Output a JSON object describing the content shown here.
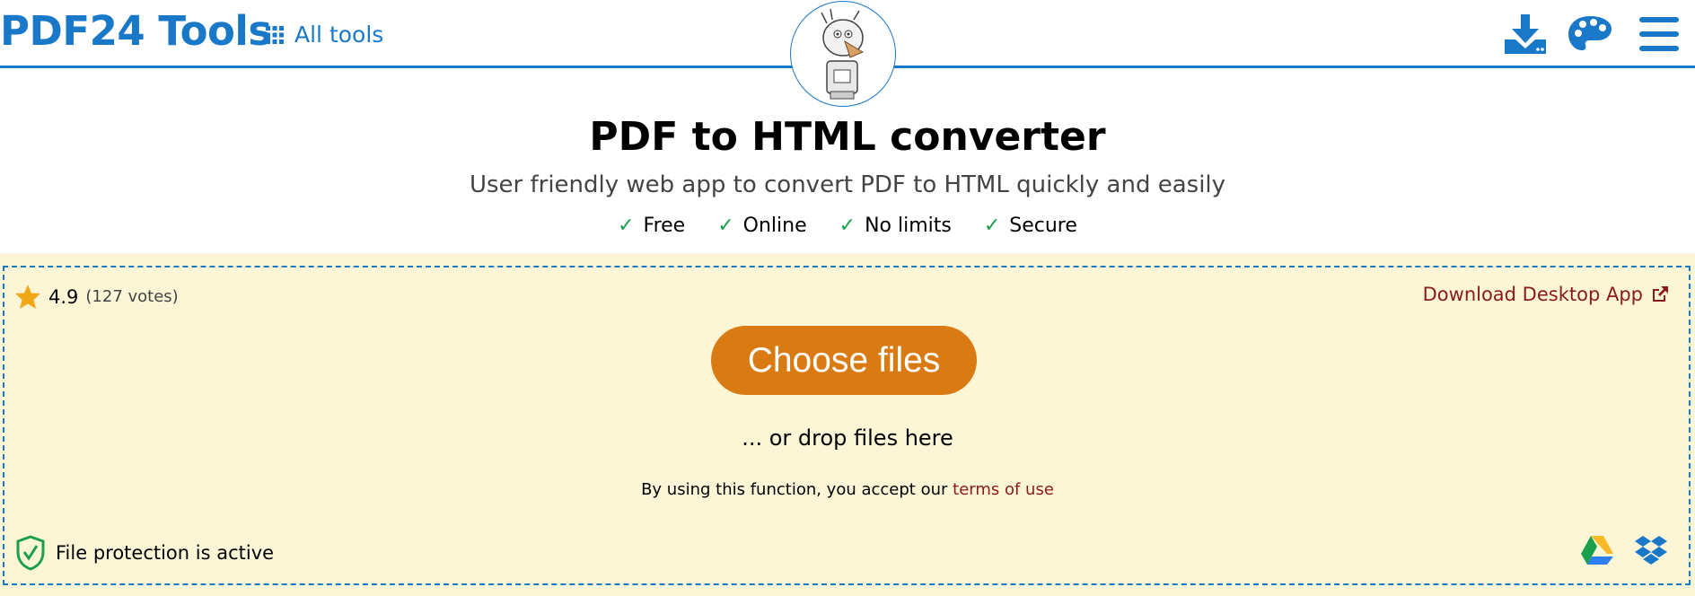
{
  "header": {
    "logo": "PDF24 Tools",
    "all_tools_label": "All tools",
    "icons": [
      "grid-icon",
      "download-icon",
      "palette-icon",
      "menu-icon"
    ],
    "mascot": "mascot-logo"
  },
  "main": {
    "title": "PDF to HTML converter",
    "subtitle": "User friendly web app to convert PDF to HTML quickly and easily",
    "features": [
      "Free",
      "Online",
      "No limits",
      "Secure"
    ],
    "check_mark": "✓"
  },
  "dropzone": {
    "rating_value": "4.9",
    "rating_votes": "(127 votes)",
    "download_desktop_label": "Download Desktop App",
    "choose_files_label": "Choose files",
    "drop_hint": "... or drop files here",
    "terms_prefix": "By using this function, you accept our",
    "terms_link": "terms of use",
    "protection_label": "File protection is active",
    "cloud_sources": [
      "google-drive-icon",
      "dropbox-icon"
    ]
  },
  "colors": {
    "brand_blue": "#1a78c9",
    "choose_button": "#d97b12",
    "dropzone_bg": "#fdf6d6",
    "link_red": "#8b1a1a",
    "check_green": "#1aa04b",
    "star": "#f0a818"
  }
}
